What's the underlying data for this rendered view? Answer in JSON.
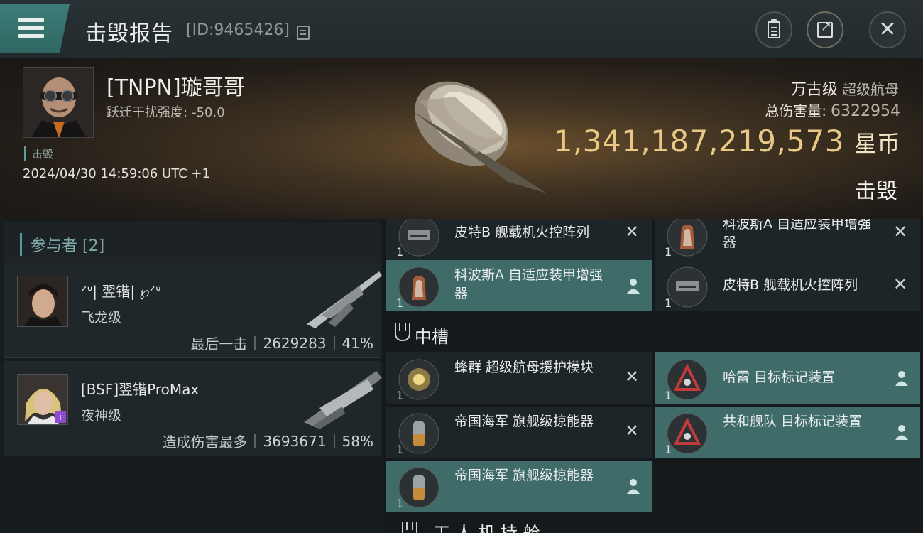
{
  "header": {
    "title": "击毁报告",
    "id_text": "[ID:9465426]"
  },
  "victim": {
    "name": "[TNPN]璇哥哥",
    "warp_label": "跃迁干扰强度:",
    "warp_value": "-50.0",
    "status_tag": "击毁",
    "datetime": "2024/04/30 14:59:06 UTC +1",
    "ship_name": "万古级",
    "ship_type": "超级航母",
    "total_damage_label": "总伤害量:",
    "total_damage_value": "6322954",
    "isk_value": "1,341,187,219,573",
    "isk_unit": "星币",
    "result": "击毁"
  },
  "participants": {
    "header": "参与者 [2]",
    "items": [
      {
        "name": "ᐟᐡ| 翌锴| ℘ᐟᐡ",
        "ship": "飞龙级",
        "note": "最后一击",
        "damage": "2629283",
        "percent": "41%"
      },
      {
        "name": "[BSF]翌锴ProMax",
        "ship": "夜神级",
        "note": "造成伤害最多",
        "damage": "3693671",
        "percent": "58%"
      }
    ]
  },
  "fitting": {
    "top_left_1": {
      "name": "皮特B 舰载机火控阵列",
      "qty": "1",
      "state": "destroyed"
    },
    "top_right_1": {
      "name": "科波斯A 自适应装甲增强器",
      "qty": "1",
      "state": "destroyed"
    },
    "top_left_2": {
      "name": "科波斯A 自适应装甲增强器",
      "qty": "1",
      "state": "dropped"
    },
    "top_right_2": {
      "name": "皮特B 舰载机火控阵列",
      "qty": "1",
      "state": "destroyed"
    },
    "mid_section_label": "中槽",
    "mid": [
      {
        "name": "蜂群 超级航母援护模块",
        "qty": "1",
        "state": "destroyed"
      },
      {
        "name": "哈雷 目标标记装置",
        "qty": "1",
        "state": "dropped"
      },
      {
        "name": "帝国海军 旗舰级掠能器",
        "qty": "1",
        "state": "destroyed"
      },
      {
        "name": "共和舰队 目标标记装置",
        "qty": "1",
        "state": "dropped"
      },
      {
        "name": "帝国海军 旗舰级掠能器",
        "qty": "1",
        "state": "dropped"
      }
    ],
    "bottom_section_label": "工 人 机 持 舱"
  },
  "colors": {
    "accent_teal": "#3f6b68",
    "isk_gold": "#e7c884",
    "menu_teal": "#3d7d78"
  },
  "icons": {
    "menu": "menu-icon",
    "copy": "copy-icon",
    "report": "clipboard-icon",
    "share": "share-icon",
    "close": "close-icon",
    "destroyed": "x-icon",
    "dropped": "person-icon"
  }
}
